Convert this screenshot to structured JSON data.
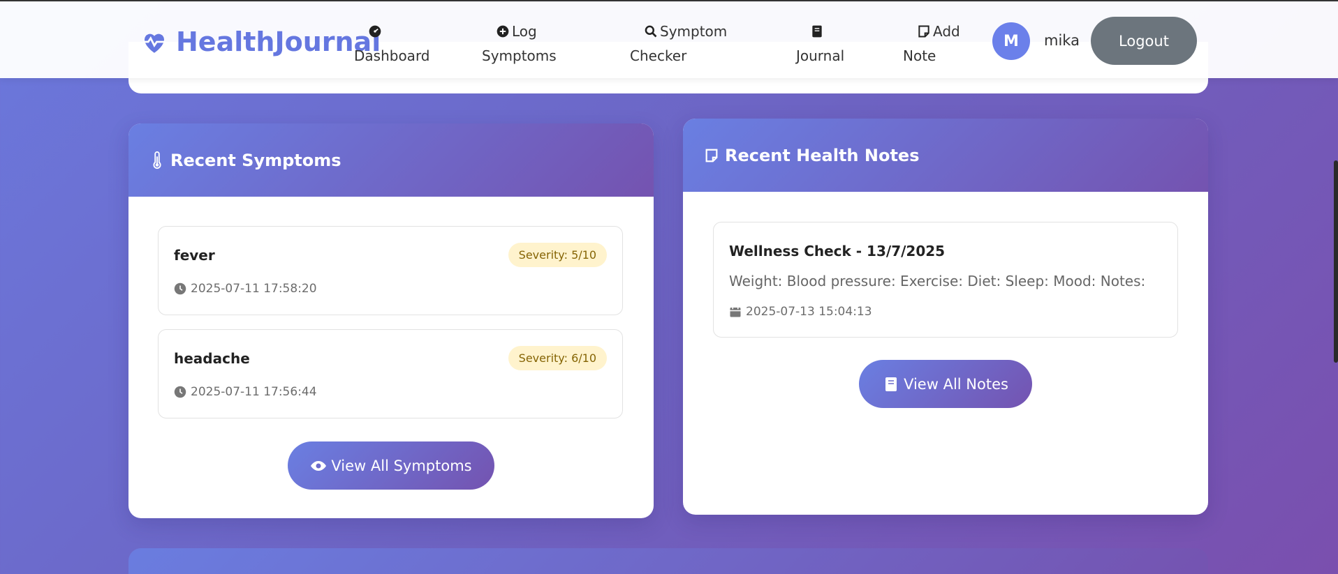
{
  "brand": {
    "name": "HealthJournal",
    "color": "#6577e0"
  },
  "nav": {
    "dashboard": [
      "Dashboard"
    ],
    "log": [
      "Log",
      "Symptoms"
    ],
    "checker": [
      "Symptom",
      "Checker"
    ],
    "journal": [
      "Journal"
    ],
    "addnote": [
      "Add",
      "Note"
    ]
  },
  "user": {
    "initial": "M",
    "name": "mika",
    "logout": "Logout"
  },
  "symptoms": {
    "title": "Recent Symptoms",
    "items": [
      {
        "name": "fever",
        "severity": "Severity: 5/10",
        "time": "2025-07-11 17:58:20"
      },
      {
        "name": "headache",
        "severity": "Severity: 6/10",
        "time": "2025-07-11 17:56:44"
      }
    ],
    "button": "View All Symptoms"
  },
  "notes": {
    "title": "Recent Health Notes",
    "items": [
      {
        "title": "Wellness Check - 13/7/2025",
        "body": "Weight: Blood pressure: Exercise: Diet: Sleep: Mood: Notes:",
        "time": "2025-07-13 15:04:13"
      }
    ],
    "button": "View All Notes"
  },
  "colors": {
    "accent": "#6a7fe2",
    "accent2": "#7453b0",
    "logout": "#6c757d",
    "badge_bg": "#fff3cd",
    "badge_text": "#856404"
  }
}
